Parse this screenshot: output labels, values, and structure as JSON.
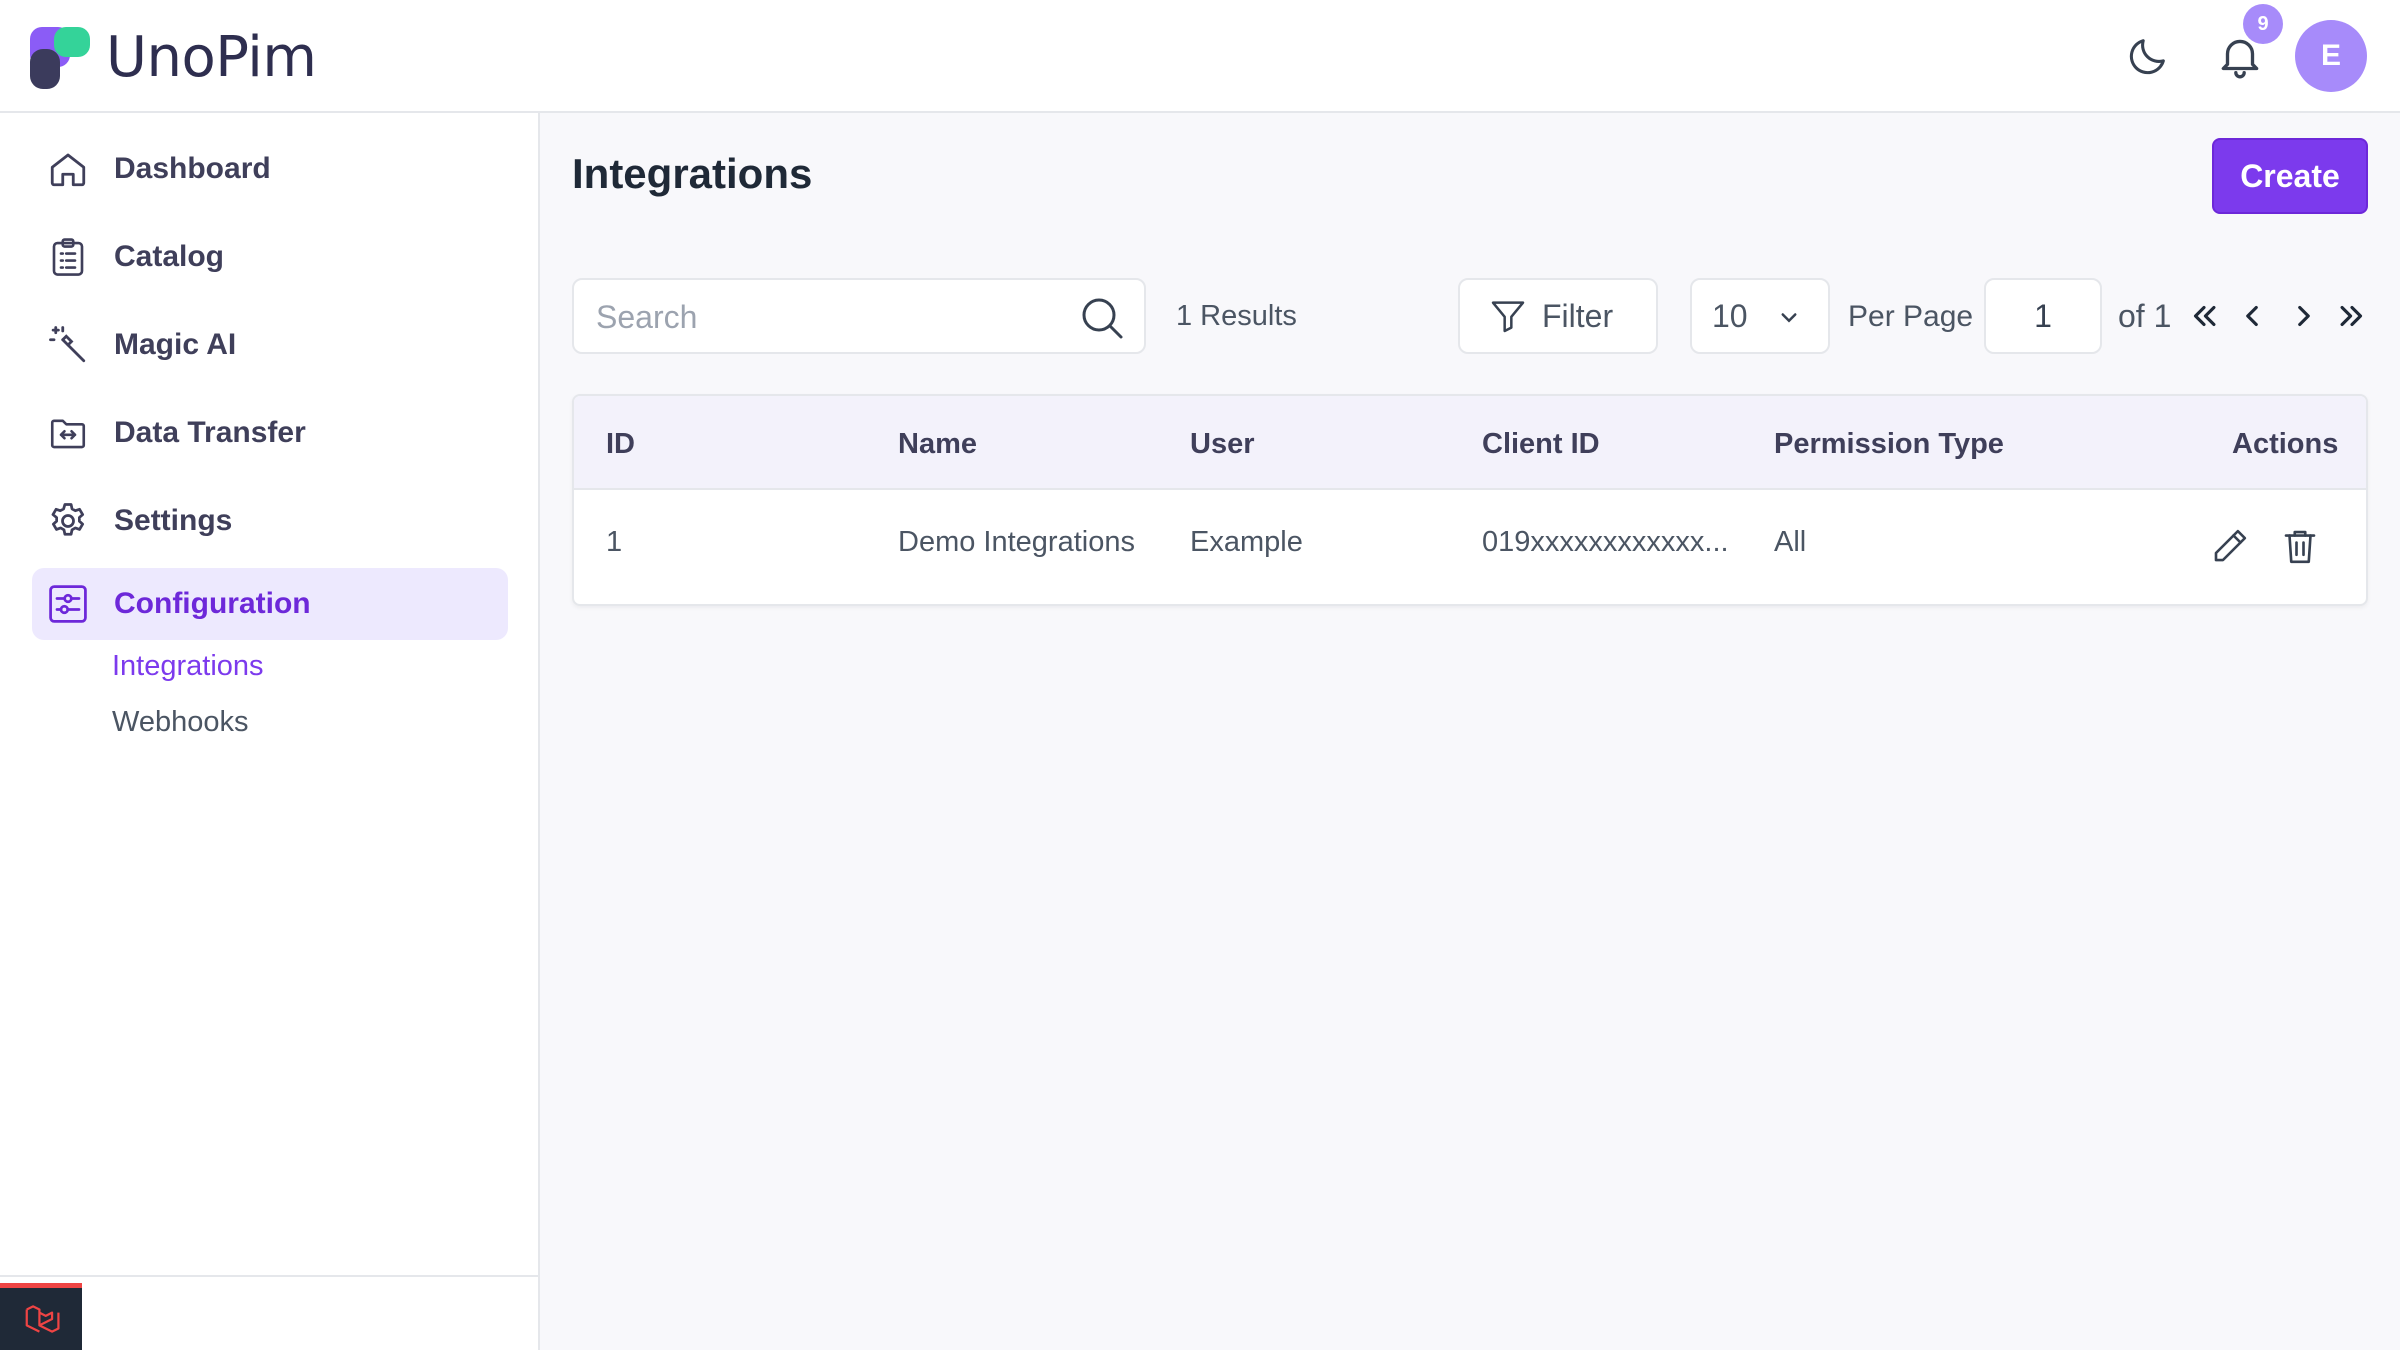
{
  "app": {
    "logo_text": "UnoPim",
    "notification_count": "9",
    "avatar_initial": "E",
    "accent_color": "#7c3aed",
    "icons": [
      "moon-icon",
      "bell-icon"
    ]
  },
  "sidebar": {
    "items": [
      {
        "label": "Dashboard",
        "icon": "home-icon"
      },
      {
        "label": "Catalog",
        "icon": "clipboard-list-icon"
      },
      {
        "label": "Magic AI",
        "icon": "magic-wand-icon"
      },
      {
        "label": "Data Transfer",
        "icon": "folder-transfer-icon"
      },
      {
        "label": "Settings",
        "icon": "gear-icon"
      },
      {
        "label": "Configuration",
        "icon": "sliders-icon",
        "active": true
      }
    ],
    "sub_items": [
      {
        "label": "Integrations",
        "active": true
      },
      {
        "label": "Webhooks"
      }
    ]
  },
  "main": {
    "title": "Integrations",
    "create_label": "Create",
    "search_placeholder": "Search",
    "results_text": "1 Results",
    "filter_label": "Filter",
    "per_page_value": "10",
    "per_page_label": "Per Page",
    "current_page": "1",
    "of_pages": "of 1"
  },
  "table": {
    "columns": [
      "ID",
      "Name",
      "User",
      "Client ID",
      "Permission Type",
      "Actions"
    ],
    "rows": [
      {
        "id": "1",
        "name": "Demo Integrations",
        "user": "Example",
        "client_id": "019xxxxxxxxxxxx...",
        "permission_type": "All"
      }
    ]
  }
}
